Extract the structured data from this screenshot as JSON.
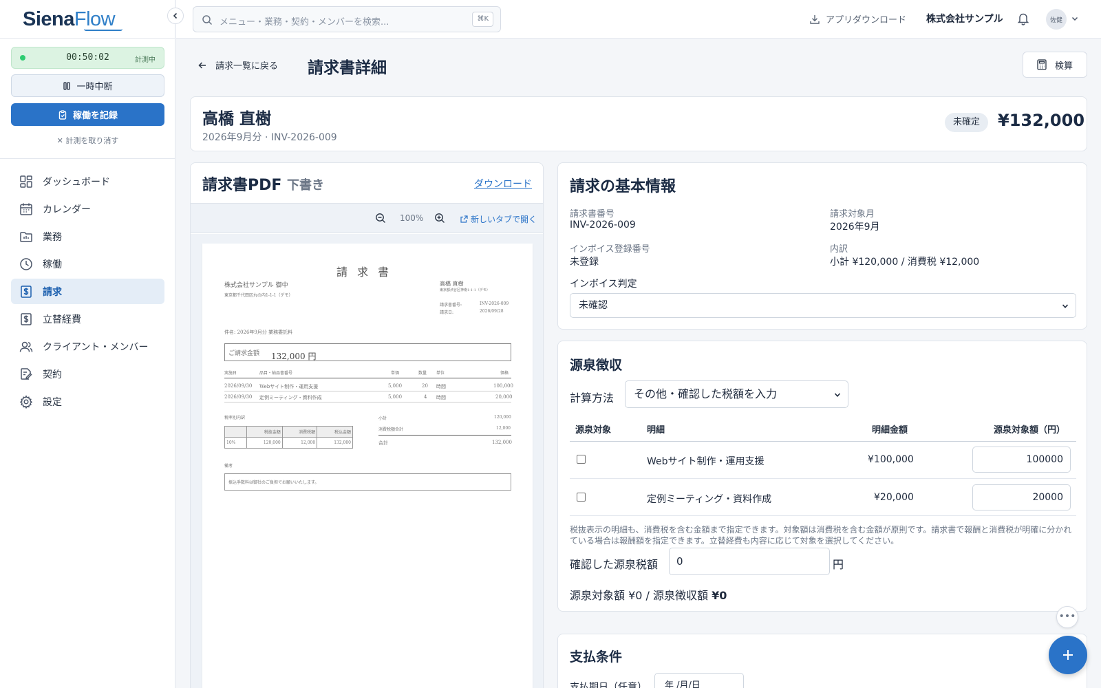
{
  "app": {
    "logo_main": "Siena",
    "logo_accent": "Flow"
  },
  "timer": {
    "time": "00:50:02",
    "status": "計測中",
    "pause_label": "一時中断",
    "record_label": "稼働を記録",
    "cancel_label": "計測を取り消す"
  },
  "sidebar": {
    "items": [
      {
        "label": "ダッシュボード",
        "icon": "dashboard-icon"
      },
      {
        "label": "カレンダー",
        "icon": "calendar-icon"
      },
      {
        "label": "業務",
        "icon": "folder-icon"
      },
      {
        "label": "稼働",
        "icon": "clock-icon"
      },
      {
        "label": "請求",
        "icon": "invoice-dollar-icon",
        "active": true
      },
      {
        "label": "立替経費",
        "icon": "expense-dollar-icon"
      },
      {
        "label": "クライアント・メンバー",
        "icon": "users-icon"
      },
      {
        "label": "契約",
        "icon": "contract-icon"
      },
      {
        "label": "設定",
        "icon": "gear-icon"
      }
    ]
  },
  "topbar": {
    "search_placeholder": "メニュー・業務・契約・メンバーを検索...",
    "shortcut": "⌘K",
    "app_download": "アプリダウンロード",
    "company": "株式会社サンプル",
    "avatar": "佐健"
  },
  "page": {
    "back_label": "請求一覧に戻る",
    "title": "請求書詳細",
    "calc_label": "検算"
  },
  "summary": {
    "client_name": "高橋 直樹",
    "subtitle": "2026年9月分 · INV-2026-009",
    "status": "未確定",
    "total": "¥132,000"
  },
  "pdf": {
    "title": "請求書PDF",
    "badge": "下書き",
    "download": "ダウンロード",
    "zoom": "100%",
    "open_new_tab": "新しいタブで開く",
    "doc": {
      "title": "請求書",
      "to_name": "株式会社サンプル 御中",
      "to_address": "東京都千代田区丸の内1-1-1（デモ）",
      "from_name": "高橋 直樹",
      "from_address": "東京都渋谷区神南1-1-1（デモ）",
      "inv_no_label": "請求書番号:",
      "inv_no": "INV-2026-009",
      "date_label": "請求日:",
      "date": "2026/09/28",
      "subject": "件名: 2026年9月分 業務委託料",
      "amount_label": "ご請求金額",
      "amount": "132,000 円",
      "cols": {
        "date": "実施日",
        "desc": "品目・納品書番号",
        "price": "単価",
        "qty": "数量",
        "unit": "単位",
        "amount": "価格"
      },
      "rows": [
        {
          "date": "2026/09/30",
          "desc": "Webサイト制作・運用支援",
          "price": "5,000",
          "qty": "20",
          "unit": "時間",
          "amount": "100,000"
        },
        {
          "date": "2026/09/30",
          "desc": "定例ミーティング・資料作成",
          "price": "5,000",
          "qty": "4",
          "unit": "時間",
          "amount": "20,000"
        }
      ],
      "tax_breakdown_label": "税率別内訳",
      "tax_cols": [
        "",
        "税抜金額",
        "消費税額",
        "税込金額"
      ],
      "tax_row": [
        "10%",
        "120,000",
        "12,000",
        "132,000"
      ],
      "subtotal_label": "小計",
      "subtotal": "120,000",
      "tax_total_label": "消費税額合計",
      "tax_total": "12,000",
      "total_label": "合計",
      "total": "132,000",
      "note_label": "備考",
      "note": "振込手数料は御社のご負担でお願いいたします。"
    }
  },
  "basic": {
    "title": "請求の基本情報",
    "inv_no_label": "請求書番号",
    "inv_no": "INV-2026-009",
    "month_label": "請求対象月",
    "month": "2026年9月",
    "invoice_reg_label": "インボイス登録番号",
    "invoice_reg": "未登録",
    "breakdown_label": "内訳",
    "breakdown": "小計 ¥120,000 / 消費税 ¥12,000",
    "judgement_label": "インボイス判定",
    "judgement": "未確認"
  },
  "withholding": {
    "title": "源泉徴収",
    "method_label": "計算方法",
    "method": "その他・確認した税額を入力",
    "headers": {
      "target": "源泉対象",
      "item": "明細",
      "amount": "明細金額",
      "target_amount": "源泉対象額（円）"
    },
    "rows": [
      {
        "item": "Webサイト制作・運用支援",
        "amount": "¥100,000",
        "target_amount": "100000"
      },
      {
        "item": "定例ミーティング・資料作成",
        "amount": "¥20,000",
        "target_amount": "20000"
      }
    ],
    "note": "税抜表示の明細も、消費税を含む金額まで指定できます。対象額は消費税を含む金額が原則です。請求書で報酬と消費税が明確に分かれている場合は報酬額を指定できます。立替経費も内容に応じて対象を選択してください。",
    "confirmed_label": "確認した源泉税額",
    "confirmed_value": "0",
    "yen": "円",
    "summary_prefix": "源泉対象額 ¥0 / 源泉徴収額 ",
    "summary_amount": "¥0"
  },
  "payment": {
    "title": "支払条件",
    "due_label": "支払期日（任意）",
    "due_placeholder": "年 /月/日"
  },
  "colors": {
    "accent": "#2a73c8",
    "sidebar_active_bg": "#e4edf7",
    "timer_bg": "#dcf3e2"
  }
}
